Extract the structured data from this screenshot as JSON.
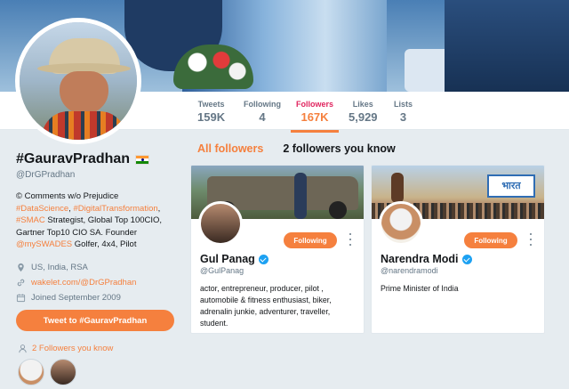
{
  "profile": {
    "name": "#GauravPradhan",
    "handle": "@DrGPradhan",
    "bio": {
      "line1": "© Comments w/o Prejudice",
      "tag1": "#DataScience",
      "sep1": ", ",
      "tag2": "#DigitalTransformation",
      "sep2": ",",
      "tag3": "#SMAC",
      "text3": " Strategist, Global Top 100CIO,",
      "line4": "Gartner Top10 CIO SA. Founder",
      "tag4": "@mySWADES",
      "text5": " Golfer, 4x4, Pilot"
    },
    "location": "US, India, RSA",
    "website": "wakelet.com/@DrGPradhan",
    "joined": "Joined September 2009",
    "tweet_to_label": "Tweet to #GauravPradhan",
    "followers_you_know": "2 Followers you know"
  },
  "stats": [
    {
      "label": "Tweets",
      "value": "159K"
    },
    {
      "label": "Following",
      "value": "4"
    },
    {
      "label": "Followers",
      "value": "167K"
    },
    {
      "label": "Likes",
      "value": "5,929"
    },
    {
      "label": "Lists",
      "value": "3"
    }
  ],
  "tabs": {
    "all": "All followers",
    "known": "2 followers you know"
  },
  "cards": [
    {
      "name": "Gul Panag",
      "handle": "@GulPanag",
      "button": "Following",
      "bio": "actor, entrepreneur, producer, pilot , automobile & fitness enthusiast, biker, adrenalin junkie, adventurer, traveller, student."
    },
    {
      "name": "Narendra Modi",
      "handle": "@narendramodi",
      "button": "Following",
      "bio": "Prime Minister of India",
      "cover_text": "भारत"
    }
  ],
  "colors": {
    "accent": "#f5803e",
    "background": "#e6ecf0",
    "verified": "#1da1f2"
  }
}
